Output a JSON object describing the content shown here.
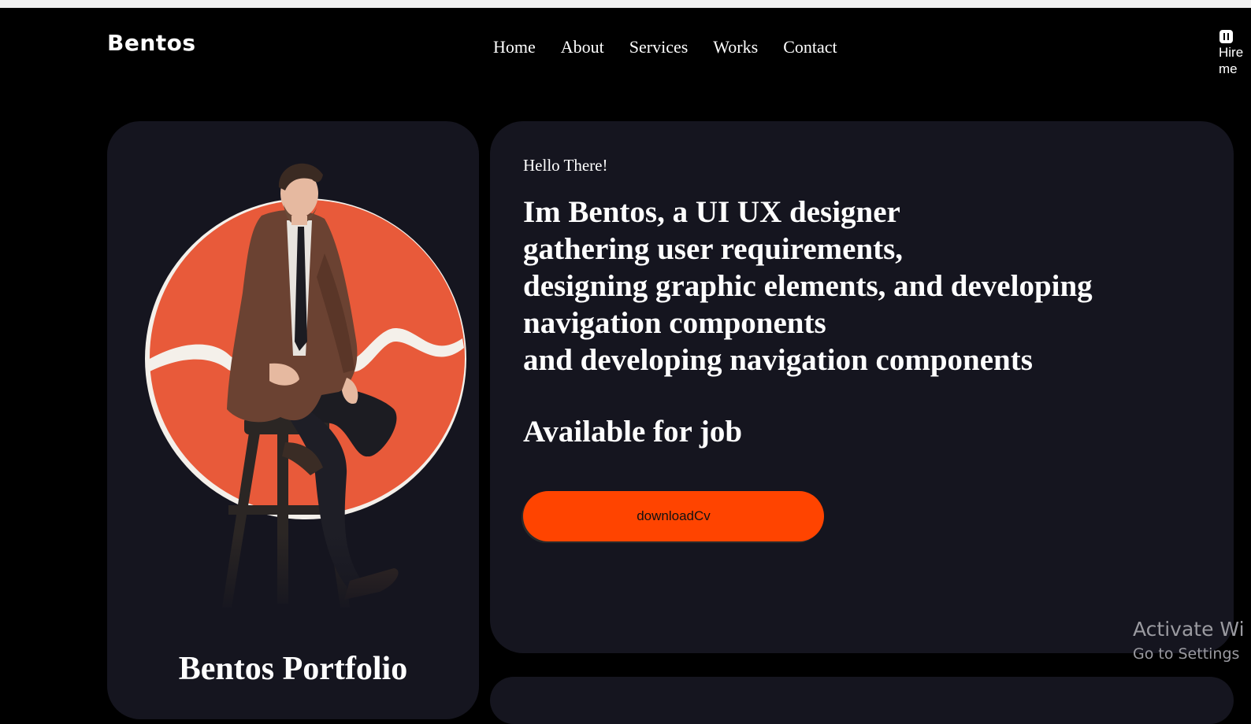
{
  "header": {
    "logo": "Bentos",
    "nav": [
      "Home",
      "About",
      "Services",
      "Works",
      "Contact"
    ],
    "hire_line1": "Hire",
    "hire_line2": "me"
  },
  "profile": {
    "title": "Bentos Portfolio",
    "accent_color": "#e85a3a"
  },
  "hero": {
    "greeting": "Hello There!",
    "headline": [
      "Im Bentos, a UI UX designer",
      "gathering user requirements,",
      "designing graphic elements, and developing",
      "navigation components",
      "and developing navigation components"
    ],
    "availability": "Available for job",
    "button_label": "downloadCv",
    "button_color": "#ff4400"
  },
  "watermark": {
    "line1": "Activate Wi",
    "line2": "Go to Settings"
  }
}
